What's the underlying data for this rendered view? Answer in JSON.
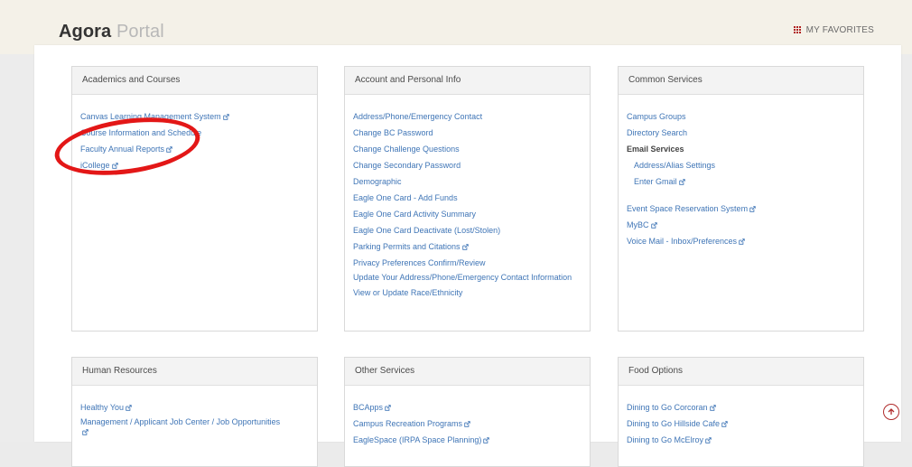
{
  "header": {
    "brand_bold": "Agora",
    "brand_light": "Portal",
    "favorites_label": "MY FAVORITES"
  },
  "panels": {
    "academics": {
      "title": "Academics and Courses",
      "items": [
        "Canvas Learning Management System",
        "Course Information and Schedule",
        "Faculty Annual Reports",
        "iCollege"
      ]
    },
    "account": {
      "title": "Account and Personal Info",
      "items": [
        "Address/Phone/Emergency Contact",
        "Change BC Password",
        "Change Challenge Questions",
        "Change Secondary Password",
        "Demographic",
        "Eagle One Card - Add Funds",
        "Eagle One Card Activity Summary",
        "Eagle One Card Deactivate (Lost/Stolen)",
        "Parking Permits and Citations",
        "Privacy Preferences Confirm/Review",
        "Update Your Address/Phone/Emergency Contact Information",
        "View or Update Race/Ethnicity"
      ]
    },
    "common": {
      "title": "Common Services",
      "items": [
        "Campus Groups",
        "Directory Search",
        "Email Services",
        "Address/Alias Settings",
        "Enter Gmail",
        "Event Space Reservation System",
        "MyBC",
        "Voice Mail - Inbox/Preferences"
      ]
    },
    "hr": {
      "title": "Human Resources",
      "items": [
        "Healthy You",
        "Management / Applicant Job Center / Job Opportunities"
      ]
    },
    "other": {
      "title": "Other Services",
      "items": [
        "BCApps",
        "Campus Recreation Programs",
        "EagleSpace (IRPA Space Planning)"
      ]
    },
    "food": {
      "title": "Food Options",
      "items": [
        "Dining to Go Corcoran",
        "Dining to Go Hillside Cafe",
        "Dining to Go McElroy"
      ]
    }
  },
  "colors": {
    "link": "#3f75b6",
    "header_bg": "#f4f1e8",
    "annotation": "#e31717",
    "favorites_icon": "#b02020"
  }
}
